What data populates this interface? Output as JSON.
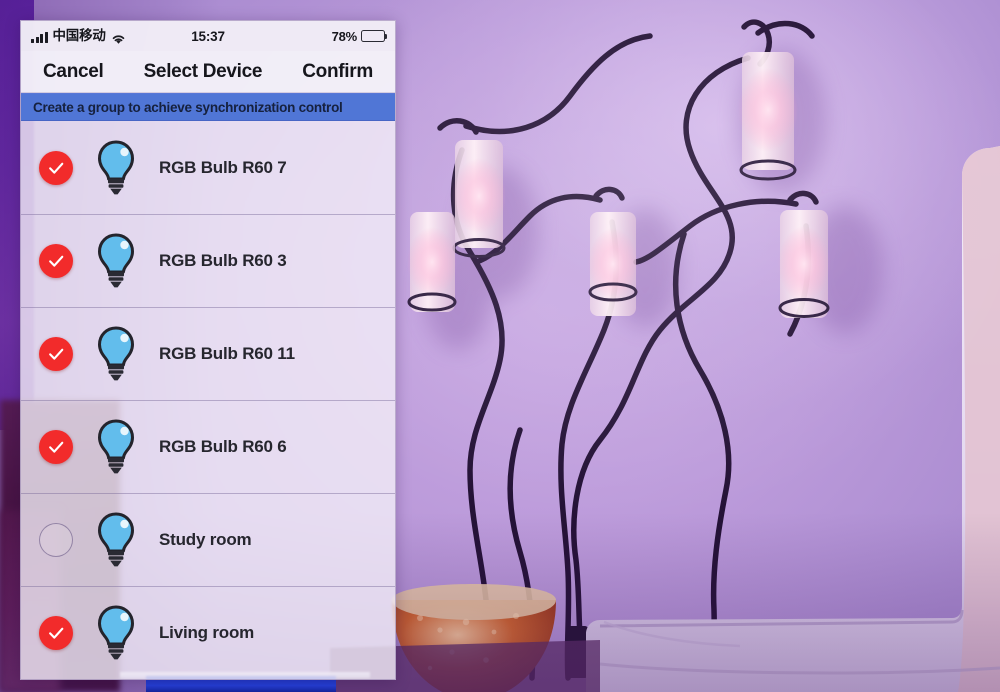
{
  "status_bar": {
    "carrier": "中国移动",
    "signal_icon": "signal-bars-icon",
    "wifi_icon": "wifi-icon",
    "time": "15:37",
    "battery_percent": "78%",
    "battery_level": 78,
    "battery_icon": "battery-icon"
  },
  "nav_bar": {
    "cancel_label": "Cancel",
    "title": "Select Device",
    "confirm_label": "Confirm"
  },
  "banner": {
    "text": "Create a group to achieve synchronization control",
    "background_color": "#5076d6",
    "text_color": "#16213e"
  },
  "device_list": {
    "checked_color": "#f22b2b",
    "bulb_color": "#62bdec",
    "items": [
      {
        "label": "RGB Bulb R60 7",
        "checked": true,
        "icon": "bulb-icon",
        "check_icon": "check-circle-filled-icon"
      },
      {
        "label": "RGB Bulb R60 3",
        "checked": true,
        "icon": "bulb-icon",
        "check_icon": "check-circle-filled-icon"
      },
      {
        "label": "RGB Bulb R60 11",
        "checked": true,
        "icon": "bulb-icon",
        "check_icon": "check-circle-filled-icon"
      },
      {
        "label": "RGB Bulb R60 6",
        "checked": true,
        "icon": "bulb-icon",
        "check_icon": "check-circle-filled-icon"
      },
      {
        "label": "Study room",
        "checked": false,
        "icon": "bulb-icon",
        "check_icon": "circle-empty-icon"
      },
      {
        "label": "Living room",
        "checked": true,
        "icon": "bulb-icon",
        "check_icon": "check-circle-filled-icon"
      }
    ]
  },
  "background": {
    "description": "purple wall with decorative branch wall-lamp and armchair",
    "wall_color": "#bb9ada",
    "accent_color": "#6b2fb0",
    "lamp_glow_color": "#ffd9ea"
  }
}
